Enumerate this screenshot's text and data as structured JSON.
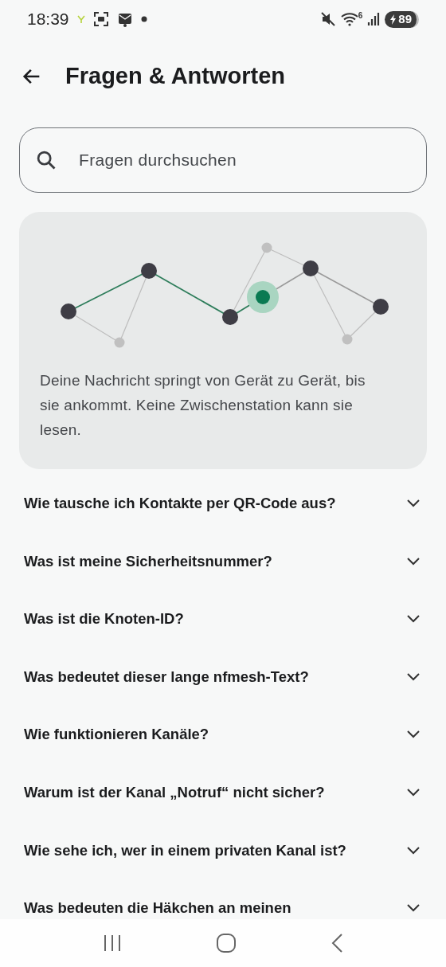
{
  "status_bar": {
    "time": "18:39",
    "wifi_badge": "6",
    "battery": "89"
  },
  "header": {
    "title": "Fragen & Antworten"
  },
  "search": {
    "placeholder": "Fragen durchsuchen"
  },
  "info_card": {
    "text": "Deine Nachricht springt von Gerät zu Gerät, bis sie ankommt. Keine Zwischenstation kann sie lesen."
  },
  "faq": [
    {
      "question": "Wie tausche ich Kontakte per QR-Code aus?",
      "expanded": false
    },
    {
      "question": "Was ist meine Sicherheitsnummer?",
      "expanded": false
    },
    {
      "question": "Was ist die Knoten-ID?",
      "expanded": false
    },
    {
      "question": "Was bedeutet dieser lange nfmesh-Text?",
      "expanded": false
    },
    {
      "question": "Wie funktionieren Kanäle?",
      "expanded": false
    },
    {
      "question": "Warum ist der Kanal „Notruf“ nicht sicher?",
      "expanded": false
    },
    {
      "question": "Wie sehe ich, wer in einem privaten Kanal ist?",
      "expanded": false
    },
    {
      "question": "Was bedeuten die Häkchen an meinen",
      "expanded": false
    }
  ]
}
